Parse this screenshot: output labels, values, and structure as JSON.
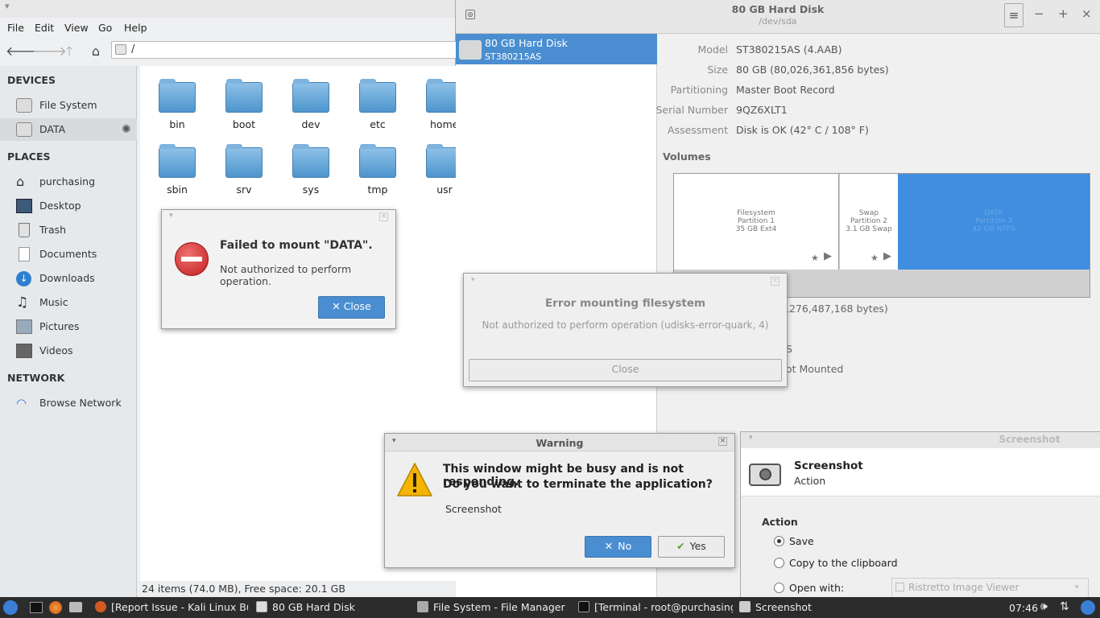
{
  "file_manager": {
    "menu": [
      "File",
      "Edit",
      "View",
      "Go",
      "Help"
    ],
    "location": "/",
    "sidebar": {
      "devices_header": "DEVICES",
      "devices": [
        "File System",
        "DATA"
      ],
      "places_header": "PLACES",
      "places": [
        "purchasing",
        "Desktop",
        "Trash",
        "Documents",
        "Downloads",
        "Music",
        "Pictures",
        "Videos"
      ],
      "network_header": "NETWORK",
      "network": [
        "Browse Network"
      ]
    },
    "folders": [
      "bin",
      "boot",
      "dev",
      "etc",
      "home",
      "sbin",
      "srv",
      "sys",
      "tmp",
      "usr"
    ],
    "status": "24 items (74.0 MB), Free space: 20.1 GB"
  },
  "disks": {
    "title": "80 GB Hard Disk",
    "subtitle": "/dev/sda",
    "list_item_title": "80 GB Hard Disk",
    "list_item_sub": "ST380215AS",
    "props": [
      {
        "k": "Model",
        "v": "ST380215AS (4.AAB)"
      },
      {
        "k": "Size",
        "v": "80 GB (80,026,361,856 bytes)"
      },
      {
        "k": "Partitioning",
        "v": "Master Boot Record"
      },
      {
        "k": "Serial Number",
        "v": "9QZ6XLT1"
      },
      {
        "k": "Assessment",
        "v": "Disk is OK (42° C / 108° F)"
      }
    ],
    "volumes_label": "Volumes",
    "partitions": [
      {
        "l1": "Filesystem",
        "l2": "Partition 1",
        "l3": "35 GB Ext4"
      },
      {
        "l1": "Swap",
        "l2": "Partition 2",
        "l3": "3.1 GB Swap"
      },
      {
        "l1": "DATA",
        "l2": "Partition 3",
        "l3": "42 GB NTFS"
      }
    ],
    "size_partial": ",276,487,168 bytes)",
    "s_partial": "S",
    "mounted_partial": "ot Mounted"
  },
  "dialog_failed": {
    "title": "Failed to mount \"DATA\".",
    "message": "Not authorized to perform operation.",
    "close": "Close"
  },
  "dialog_error": {
    "title": "Error mounting filesystem",
    "message": "Not authorized to perform operation (udisks-error-quark, 4)",
    "close": "Close"
  },
  "dialog_warning": {
    "window_title": "Warning",
    "line1": "This window might be busy and is not responding.",
    "line2": "Do you want to terminate the application?",
    "app": "Screenshot",
    "no": "No",
    "yes": "Yes"
  },
  "screenshot": {
    "window_title": "Screenshot",
    "header_title": "Screenshot",
    "header_sub": "Action",
    "section": "Action",
    "options": [
      "Save",
      "Copy to the clipboard",
      "Open with:"
    ],
    "open_with_value": "Ristretto Image Viewer"
  },
  "taskbar": {
    "tasks": [
      "[Report Issue - Kali Linux Bu...",
      "80 GB Hard Disk",
      "File System - File Manager",
      "[Terminal - root@purchasing...",
      "Screenshot"
    ],
    "clock": "07:46"
  }
}
